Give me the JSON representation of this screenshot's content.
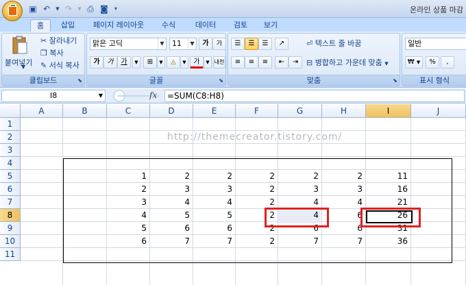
{
  "title": "온라인 상품 마감",
  "tabs": [
    "홈",
    "삽입",
    "페이지 레이아웃",
    "수식",
    "데이터",
    "검토",
    "보기"
  ],
  "clipboard": {
    "paste": "붙여넣기",
    "cut": "잘라내기",
    "copy": "복사",
    "format_painter": "서식 복사",
    "label": "클립보드"
  },
  "font": {
    "name": "맑은 고딕",
    "size": "11",
    "bold": "가",
    "italic": "가",
    "underline": "가",
    "label": "글꼴",
    "grow": "가",
    "shrink": "가",
    "fontcolor": "가",
    "phonetic": "내천"
  },
  "alignment": {
    "wrap": "텍스트 줄 바꿈",
    "merge": "병합하고 가운데 맞춤",
    "label": "맞춤"
  },
  "number": {
    "format": "일반",
    "label": "표시 형식",
    "currency": "₩",
    "percent": "%",
    "comma": ","
  },
  "formula_bar": {
    "name_box": "I8",
    "fx": "fx",
    "formula": "=SUM(C8:H8)"
  },
  "columns": [
    "A",
    "B",
    "C",
    "D",
    "E",
    "F",
    "G",
    "H",
    "I",
    "J"
  ],
  "rows": [
    "1",
    "2",
    "3",
    "4",
    "5",
    "6",
    "7",
    "8",
    "9",
    "10",
    "11"
  ],
  "watermark": "http://themecreator.tistory.com/",
  "table": [
    [
      "1",
      "2",
      "2",
      "2",
      "2",
      "2",
      "11"
    ],
    [
      "2",
      "3",
      "3",
      "2",
      "3",
      "3",
      "16"
    ],
    [
      "3",
      "4",
      "4",
      "2",
      "4",
      "4",
      "21"
    ],
    [
      "4",
      "5",
      "5",
      "2",
      "4",
      "6",
      "26"
    ],
    [
      "5",
      "6",
      "6",
      "2",
      "6",
      "6",
      "31"
    ],
    [
      "6",
      "7",
      "7",
      "2",
      "7",
      "7",
      "36"
    ]
  ]
}
